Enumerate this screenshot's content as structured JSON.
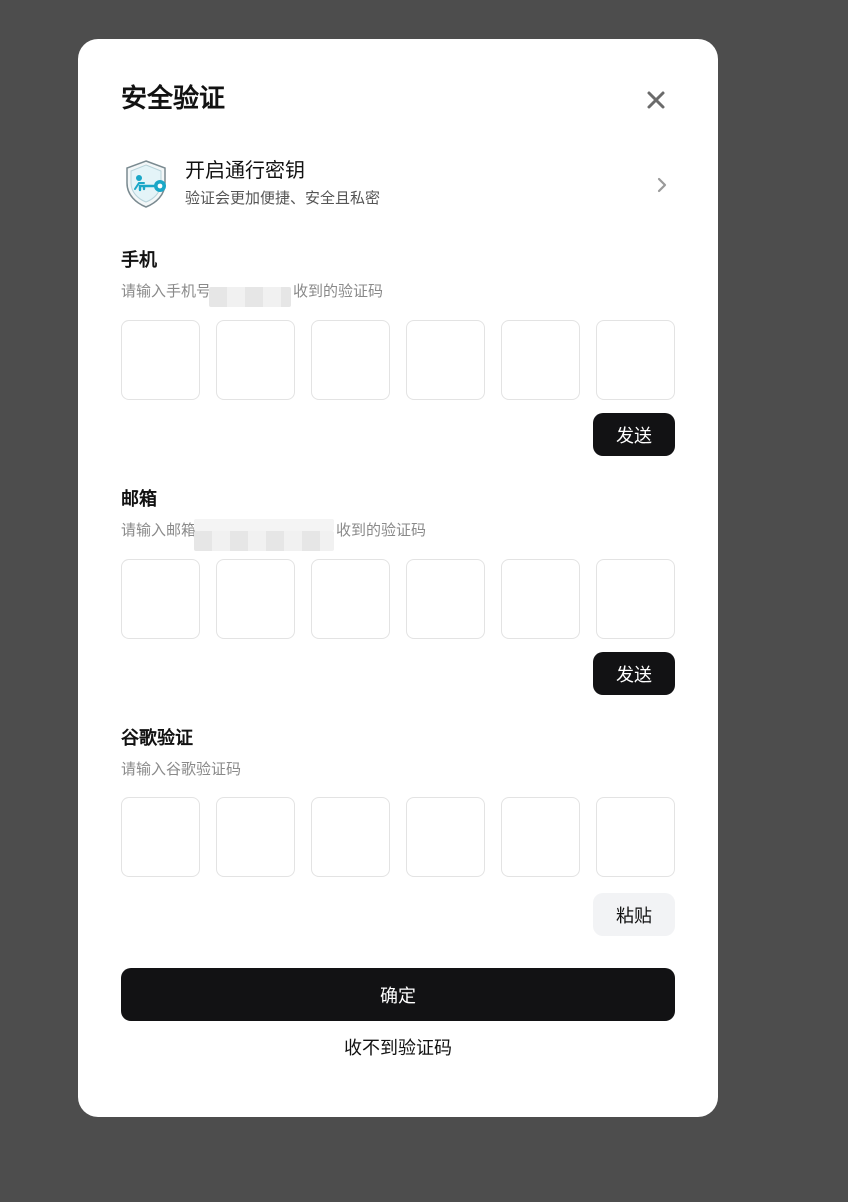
{
  "modal": {
    "title": "安全验证",
    "close_icon": "close-icon"
  },
  "passkey": {
    "title": "开启通行密钥",
    "subtitle": "验证会更加便捷、安全且私密",
    "icon": "shield-key-icon",
    "chevron": "chevron-right-icon",
    "accent": "#1aa7c7"
  },
  "phone": {
    "label": "手机",
    "hint_prefix": "请输入手机号",
    "hint_suffix": "收到的验证码",
    "send_label": "发送"
  },
  "email": {
    "label": "邮箱",
    "hint_prefix": "请输入邮箱",
    "hint_suffix": "收到的验证码",
    "send_label": "发送"
  },
  "google": {
    "label": "谷歌验证",
    "hint": "请输入谷歌验证码",
    "paste_label": "粘贴"
  },
  "actions": {
    "confirm_label": "确定",
    "no_code_label": "收不到验证码"
  },
  "colors": {
    "overlay": "#4d4d4d",
    "primary_button": "#121214",
    "paste_button": "#f2f3f5",
    "box_border": "#e3e3e3"
  }
}
